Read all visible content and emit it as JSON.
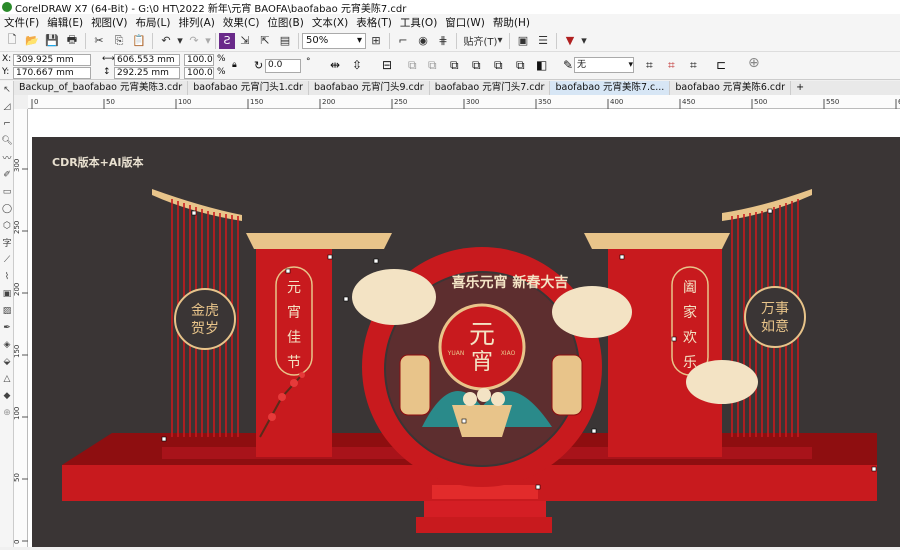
{
  "window": {
    "title": "CorelDRAW X7 (64-Bit) - G:\\0 HT\\2022 新年\\元宵 BAOFA\\baofabao 元宵美陈7.cdr"
  },
  "menu": [
    "文件(F)",
    "编辑(E)",
    "视图(V)",
    "布局(L)",
    "排列(A)",
    "效果(C)",
    "位图(B)",
    "文本(X)",
    "表格(T)",
    "工具(O)",
    "窗口(W)",
    "帮助(H)"
  ],
  "toolbar": {
    "zoom_value": "50%",
    "snap_label": "贴齐(T)"
  },
  "properties": {
    "x_label": "X:",
    "x_value": "309.925 mm",
    "y_label": "Y:",
    "y_value": "170.667 mm",
    "w_value": "606.553 mm",
    "h_value": "292.25 mm",
    "sx_value": "100.0",
    "sy_value": "100.0",
    "pct": "%",
    "rotation_value": "0.0",
    "deg": "°",
    "outline_value": "无"
  },
  "tabs": [
    {
      "label": "Backup_of_baofabao 元宵美陈3.cdr",
      "active": false
    },
    {
      "label": "baofabao 元宵门头1.cdr",
      "active": false
    },
    {
      "label": "baofabao 元宵门头9.cdr",
      "active": false
    },
    {
      "label": "baofabao 元宵门头7.cdr",
      "active": false
    },
    {
      "label": "baofabao 元宵美陈7.c...",
      "active": true
    },
    {
      "label": "baofabao 元宵美陈6.cdr",
      "active": false
    }
  ],
  "ruler_h": [
    "0",
    "50",
    "100",
    "150",
    "200",
    "250",
    "300",
    "350",
    "400",
    "450",
    "500",
    "550",
    "600"
  ],
  "ruler_v": [
    "300",
    "250",
    "200",
    "150",
    "100",
    "50",
    "0"
  ],
  "canvas": {
    "watermark": "CDR版本+AI版本",
    "banner": "喜乐元宵 新春大吉",
    "center_char_1": "元",
    "center_char_2": "宵",
    "pinyin_left": "YUAN",
    "pinyin_right": "XIAO",
    "left_panel": [
      "元",
      "宵",
      "佳",
      "节"
    ],
    "right_panel": [
      "阖",
      "家",
      "欢",
      "乐"
    ],
    "left_badge": [
      "金虎",
      "贺岁"
    ],
    "right_badge": [
      "万事",
      "如意"
    ]
  },
  "colors": {
    "red": "#c81a1e",
    "dark_red": "#8e0e10",
    "gold": "#e8c48a",
    "bg": "#3a3535",
    "cream": "#f3e3c4"
  }
}
